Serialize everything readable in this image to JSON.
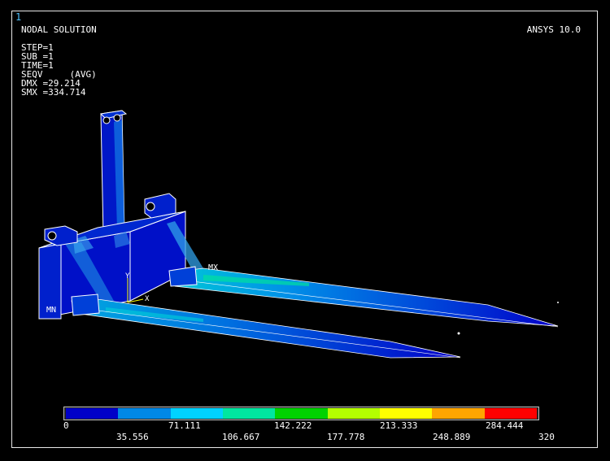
{
  "window": {
    "number": "1"
  },
  "plot": {
    "title": "NODAL SOLUTION",
    "software": "ANSYS 10.0",
    "info": [
      "STEP=1",
      "SUB =1",
      "TIME=1",
      "SEQV     (AVG)",
      "DMX =29.214",
      "SMX =334.714"
    ]
  },
  "markers": {
    "max": "MX",
    "min": "MN",
    "axis_y": "Y",
    "axis_x": "X"
  },
  "legend": {
    "colors": [
      "#0000c8",
      "#0088e6",
      "#00d2ff",
      "#00e6a0",
      "#00d200",
      "#b4ff00",
      "#ffff00",
      "#ffa500",
      "#ff0000"
    ],
    "labels_top": [
      "0",
      "71.111",
      "142.222",
      "213.333",
      "284.444"
    ],
    "labels_bottom": [
      "35.556",
      "106.667",
      "177.778",
      "248.889",
      "320"
    ]
  }
}
